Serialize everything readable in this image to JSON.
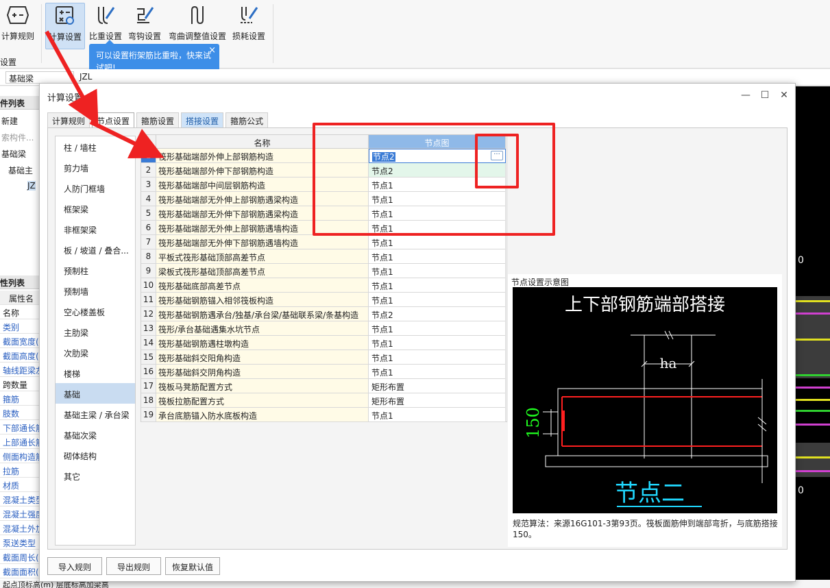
{
  "ribbon": {
    "buttons": [
      {
        "label": "计算规则",
        "icon": "calc-rule-icon"
      },
      {
        "label": "计算设置",
        "icon": "calc-settings-icon"
      },
      {
        "label": "比重设置",
        "icon": "density-settings-icon"
      },
      {
        "label": "弯钩设置",
        "icon": "hook-settings-icon"
      },
      {
        "label": "弯曲调整值设置",
        "icon": "bend-adjust-icon"
      },
      {
        "label": "损耗设置",
        "icon": "loss-settings-icon"
      }
    ],
    "group_label": "设置"
  },
  "tooltip": {
    "text": "可以设置桁架筋比重啦，快来试试吧!",
    "close": "×"
  },
  "bg": {
    "toolbar_cells": [
      "基础梁",
      "JZL"
    ],
    "left_headers": [
      "件列表",
      "性列表"
    ],
    "left_tree": [
      "新建",
      "索构件...",
      "基础梁",
      "基础主",
      "JZ"
    ],
    "prop_header": "属性名",
    "props": [
      "名称",
      "类别",
      "截面宽度(",
      "截面高度(",
      "轴线距梁左",
      "跨数量",
      "箍筋",
      "肢数",
      "下部通长筋",
      "上部通长筋",
      "侧面构造筋",
      "拉筋",
      "材质",
      "混凝土类型",
      "混凝土强度",
      "混凝土外加",
      "泵送类型",
      "截面周长(",
      "截面面积("
    ],
    "bottom_text": "起点顶标高(m)    层底标高加梁高",
    "cad_labels": [
      "0",
      "0"
    ]
  },
  "dialog": {
    "title": "计算设置",
    "controls": {
      "minimize": "—",
      "maximize": "☐",
      "close": "✕"
    },
    "tabs": [
      "计算规则",
      "节点设置",
      "箍筋设置",
      "搭接设置",
      "箍筋公式"
    ],
    "active_tab": 1,
    "categories": [
      "柱 / 墙柱",
      "剪力墙",
      "人防门框墙",
      "框架梁",
      "非框架梁",
      "板 / 坡道 / 叠合...",
      "预制柱",
      "预制墙",
      "空心楼盖板",
      "主肋梁",
      "次肋梁",
      "楼梯",
      "基础",
      "基础主梁 / 承台梁",
      "基础次梁",
      "砌体结构",
      "其它"
    ],
    "selected_category": 12,
    "grid": {
      "headers": {
        "num": "",
        "name": "名称",
        "value": "节点图"
      },
      "rows": [
        {
          "num": "1",
          "name": "筏形基础端部外伸上部钢筋构造",
          "value": "节点2"
        },
        {
          "num": "2",
          "name": "筏形基础端部外伸下部钢筋构造",
          "value": "节点2"
        },
        {
          "num": "3",
          "name": "筏形基础端部中间层钢筋构造",
          "value": "节点1"
        },
        {
          "num": "4",
          "name": "筏形基础端部无外伸上部钢筋遇梁构造",
          "value": "节点1"
        },
        {
          "num": "5",
          "name": "筏形基础端部无外伸下部钢筋遇梁构造",
          "value": "节点1"
        },
        {
          "num": "6",
          "name": "筏形基础端部无外伸上部钢筋遇墙构造",
          "value": "节点1"
        },
        {
          "num": "7",
          "name": "筏形基础端部无外伸下部钢筋遇墙构造",
          "value": "节点1"
        },
        {
          "num": "8",
          "name": "平板式筏形基础顶部高差节点",
          "value": "节点1"
        },
        {
          "num": "9",
          "name": "梁板式筏形基础顶部高差节点",
          "value": "节点1"
        },
        {
          "num": "10",
          "name": "筏形基础底部高差节点",
          "value": "节点1"
        },
        {
          "num": "11",
          "name": "筏形基础钢筋锚入相邻筏板构造",
          "value": "节点1"
        },
        {
          "num": "12",
          "name": "筏形基础钢筋遇承台/独基/承台梁/基础联系梁/条基构造",
          "value": "节点2"
        },
        {
          "num": "13",
          "name": "筏形/承台基础遇集水坑节点",
          "value": "节点1"
        },
        {
          "num": "14",
          "name": "筏形基础钢筋遇柱墩构造",
          "value": "节点1"
        },
        {
          "num": "15",
          "name": "筏形基础斜交阳角构造",
          "value": "节点1"
        },
        {
          "num": "16",
          "name": "筏形基础斜交阴角构造",
          "value": "节点1"
        },
        {
          "num": "17",
          "name": "筏板马凳筋配置方式",
          "value": "矩形布置"
        },
        {
          "num": "18",
          "name": "筏板拉筋配置方式",
          "value": "矩形布置"
        },
        {
          "num": "19",
          "name": "承台底筋锚入防水底板构造",
          "value": "节点1"
        }
      ],
      "ellipsis": "···"
    },
    "preview": {
      "title": "节点设置示意图",
      "image_title": "上下部钢筋端部搭接",
      "dim_ha": "ha",
      "dim_150": "150",
      "image_caption": "节点二",
      "note": "规范算法：来源16G101-3第93页。筏板面筋伸到端部弯折，与底筋搭接150。"
    },
    "footer": [
      "导入规则",
      "导出规则",
      "恢复默认值"
    ]
  },
  "colors": {
    "accent": "#3a7bd5",
    "annotation": "#e22222",
    "tooltip": "#3d8ee8",
    "selected_cat": "#c9dcf1"
  }
}
